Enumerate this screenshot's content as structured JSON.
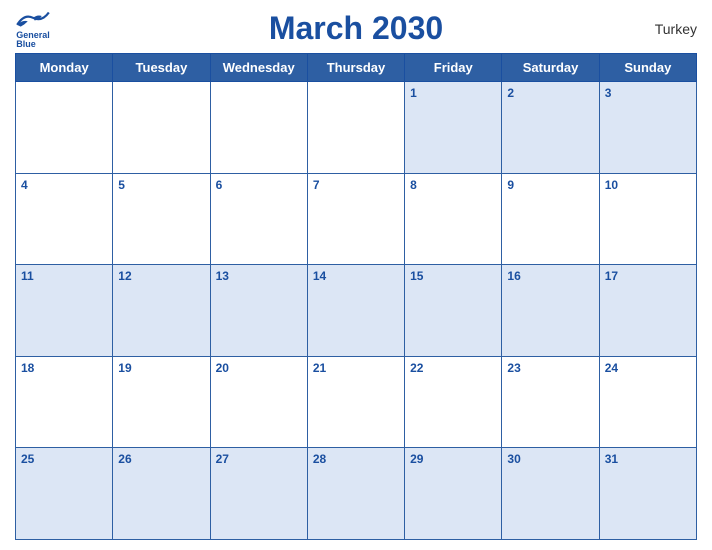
{
  "header": {
    "title": "March 2030",
    "country": "Turkey",
    "logo_line1": "General",
    "logo_line2": "Blue"
  },
  "days_of_week": [
    "Monday",
    "Tuesday",
    "Wednesday",
    "Thursday",
    "Friday",
    "Saturday",
    "Sunday"
  ],
  "weeks": [
    [
      null,
      null,
      null,
      null,
      1,
      2,
      3
    ],
    [
      4,
      5,
      6,
      7,
      8,
      9,
      10
    ],
    [
      11,
      12,
      13,
      14,
      15,
      16,
      17
    ],
    [
      18,
      19,
      20,
      21,
      22,
      23,
      24
    ],
    [
      25,
      26,
      27,
      28,
      29,
      30,
      31
    ]
  ]
}
